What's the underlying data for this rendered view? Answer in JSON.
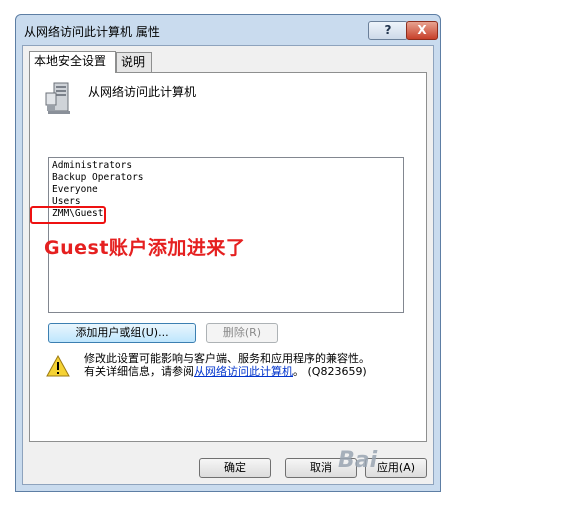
{
  "window": {
    "title": "从网络访问此计算机 属性",
    "help_label": "?",
    "close_label": "X"
  },
  "tabs": [
    {
      "label": "本地安全设置"
    },
    {
      "label": "说明"
    }
  ],
  "policy": {
    "name": "从网络访问此计算机"
  },
  "list": {
    "items": [
      {
        "label": "Administrators"
      },
      {
        "label": "Backup Operators"
      },
      {
        "label": "Everyone"
      },
      {
        "label": "Users"
      },
      {
        "label": "ZMM\\Guest"
      }
    ]
  },
  "annotation": {
    "text": "Guest账户添加进来了",
    "color": "#e52020"
  },
  "buttons": {
    "add": "添加用户或组(U)...",
    "remove": "删除(R)",
    "ok": "确定",
    "cancel": "取消",
    "apply": "应用(A)"
  },
  "warning": {
    "line1": "修改此设置可能影响与客户端、服务和应用程序的兼容性。",
    "line2_prefix": "有关详细信息，请参阅",
    "link": "从网络访问此计算机",
    "kb": "。 (Q823659)"
  },
  "watermark": "Bai",
  "colors": {
    "accent": "#3c7fb1",
    "frame": "#c9dbee",
    "close": "#c7402a"
  }
}
